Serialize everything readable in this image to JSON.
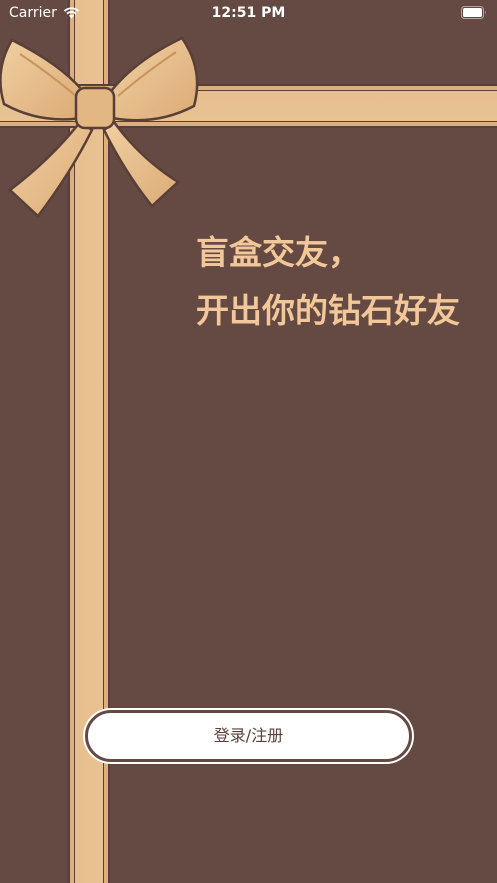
{
  "status_bar": {
    "carrier": "Carrier",
    "time": "12:51 PM",
    "icons": [
      "wifi-icon",
      "battery-icon"
    ]
  },
  "hero": {
    "line1": "盲盒交友，",
    "line2": "开出你的钻石好友"
  },
  "login_button": {
    "label": "登录/注册"
  },
  "colors": {
    "background": "#644a43",
    "ribbon": "#e9c293",
    "ribbon_edge": "#5a3f38",
    "headline": "#f2c89a",
    "button_bg": "#ffffff",
    "button_text": "#5a3f38"
  }
}
